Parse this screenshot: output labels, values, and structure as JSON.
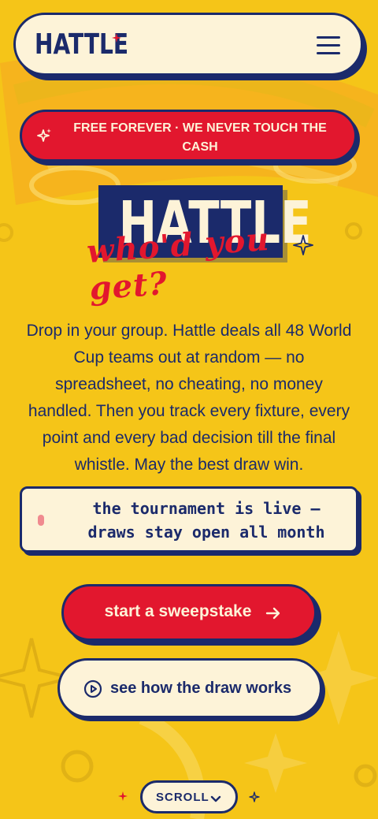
{
  "header": {
    "logo": "HATTLE",
    "menu_icon": "hamburger-menu-icon"
  },
  "banner": {
    "icon": "sparkle-icon",
    "text": "FREE FOREVER · WE NEVER TOUCH THE CASH"
  },
  "hero": {
    "title": "HATTLE",
    "tagline": "who'd you get?"
  },
  "intro": "Drop in your group. Hattle deals all 48 World Cup teams out at random — no spreadsheet, no cheating, no money handled. Then you track every fixture, every point and every bad decision till the final whistle. May the best draw win.",
  "notice": {
    "line1": "the tournament is live —",
    "line2": "draws stay open all month"
  },
  "cta": {
    "primary": "start a sweepstake",
    "primary_icon": "arrow-right-icon",
    "secondary": "see how the draw works",
    "secondary_icon": "play-circle-icon"
  },
  "scroll": {
    "label": "SCROLL",
    "icon": "chevron-down-icon"
  },
  "colors": {
    "background": "#f5c518",
    "navy": "#1b2a6b",
    "red": "#e2172e",
    "cream": "#fdf3d8"
  }
}
